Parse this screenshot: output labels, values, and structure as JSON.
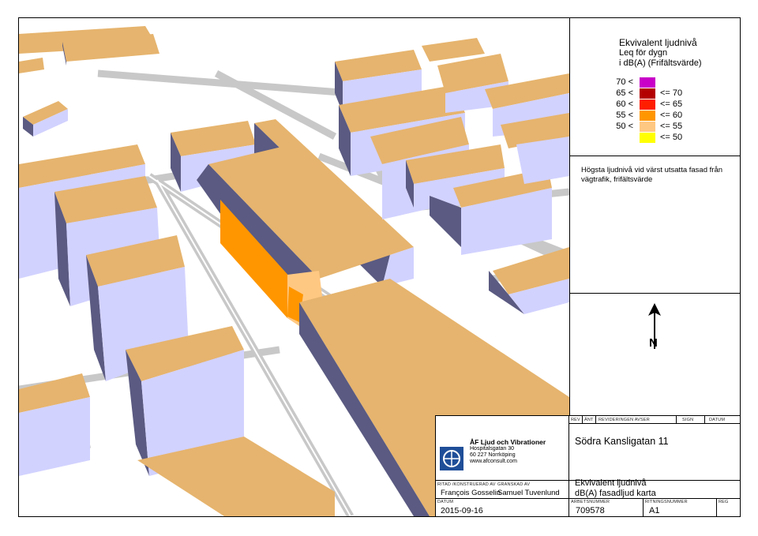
{
  "legend": {
    "title_line1": "Ekvivalent ljudnivå",
    "title_line2": "Leq för dygn",
    "title_line3": "i dB(A) (Frifältsvärde)",
    "rows": [
      {
        "lo": "70 <",
        "hi": "",
        "color": "#c800c8"
      },
      {
        "lo": "65 <",
        "hi": "<= 70",
        "color": "#b40000"
      },
      {
        "lo": "60 <",
        "hi": "<= 65",
        "color": "#ff1e00"
      },
      {
        "lo": "55 <",
        "hi": "<= 60",
        "color": "#ff9600"
      },
      {
        "lo": "50 <",
        "hi": "<= 55",
        "color": "#ffc882"
      },
      {
        "lo": "",
        "hi": "<= 50",
        "color": "#ffff00"
      }
    ],
    "note": "Högsta ljudnivå vid värst utsatta fasad från vägtrafik, frifältsvärde"
  },
  "north_arrow": {
    "icon": "north-arrow-icon",
    "letter": "N"
  },
  "title_block": {
    "company": "ÅF Ljud och Vibrationer",
    "address1": "Hospitalsgatan 30",
    "address2": "60 227 Norrköping",
    "website": "www.afconsult.com",
    "logo_text": "ÅF",
    "hdr_rev": "REV",
    "hdr_ant": "ÄNT",
    "hdr_revision": "REVIDERINGEN AVSER",
    "hdr_sign": "SIGN",
    "hdr_datum": "DATUM",
    "project": "Södra Kansligatan 11",
    "ritad_label": "RITAD /KONSTRUERAD AV",
    "granskad_label": "GRANSKAD AV",
    "ritad_by": "François Gosselin",
    "granskad_by": "Samuel Tuvenlund",
    "datum_label": "DATUM",
    "date": "2015-09-16",
    "drawing_title1": "Ekvivalent ljudnivå",
    "drawing_title2": "dB(A) fasadljud karta",
    "arbetsnummer_label": "ARBETSNUMMER",
    "arbetsnummer": "709578",
    "ritningsnummer_label": "RITNINGSNUMMER",
    "ritningsnummer": "A1",
    "reg_label": "REG"
  },
  "colors": {
    "roof": "#e6b46e",
    "wall_light": "#d2d2ff",
    "wall_dark": "#5a5a82",
    "road": "#c8c8c8",
    "noise_55_60": "#ff9600",
    "noise_50_55": "#ffc882"
  }
}
